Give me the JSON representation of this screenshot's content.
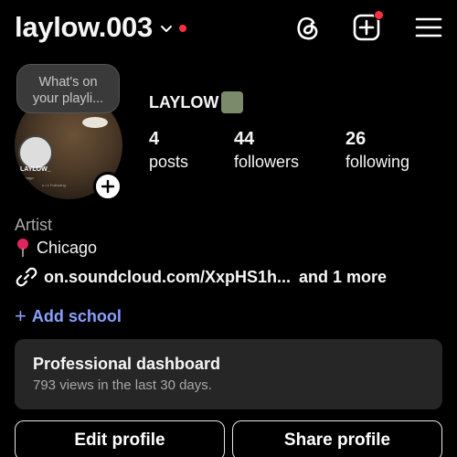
{
  "header": {
    "username": "laylow.003",
    "icons": [
      "threads-icon",
      "create-icon",
      "menu-icon"
    ],
    "accent_red": "#ff3040"
  },
  "avatar": {
    "note_line1": "What's on",
    "note_line2": "your playli...",
    "inner_name": "LAYLOW_",
    "inner_sub": "Chicago",
    "inner_follow": "s • 1 Following"
  },
  "profile": {
    "display_name": "LAYLOW",
    "stats": [
      {
        "num": "4",
        "label": "posts"
      },
      {
        "num": "44",
        "label": "followers"
      },
      {
        "num": "26",
        "label": "following"
      }
    ],
    "category": "Artist",
    "location": "Chicago",
    "link": "on.soundcloud.com/XxpHS1h...",
    "link_more": "and 1 more",
    "add_school": "Add school",
    "link_color": "#8aa0ff"
  },
  "dashboard": {
    "title": "Professional dashboard",
    "subtitle": "793 views in the last 30 days."
  },
  "buttons": {
    "edit": "Edit profile",
    "share": "Share profile"
  }
}
